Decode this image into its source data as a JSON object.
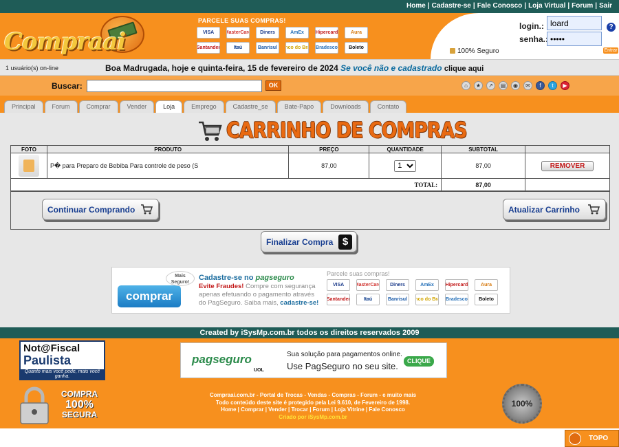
{
  "top_nav": {
    "links": [
      "Home",
      "Cadastre-se",
      "Fale Conosco",
      "Loja Virtual",
      "Forum",
      "Sair"
    ],
    "separator": "|"
  },
  "header": {
    "logo_text": "Compraai",
    "parcele_title": "PARCELE SUAS COMPRAS!",
    "cards": [
      "VISA",
      "MasterCard",
      "Diners",
      "AmEx",
      "Hipercard",
      "Aura",
      "Santander",
      "Itaú",
      "Banrisul",
      "Banco do Brasil",
      "Bradesco",
      "Boleto"
    ]
  },
  "login": {
    "login_label": "login.:",
    "login_value": "loard",
    "senha_label": "senha.:",
    "senha_value": "•••••",
    "secure_text": "100% Seguro",
    "entrar_label": "Entrar"
  },
  "infobar": {
    "online_text": "1 usuário(s) on-line",
    "greeting": "Boa Madrugada, hoje e quinta-feira, 15 de fevereiro de 2024",
    "not_registered": "Se você não e cadastrado",
    "click_here": "clique aqui"
  },
  "search": {
    "label": "Buscar:",
    "value": "",
    "ok_label": "OK"
  },
  "tabs": [
    {
      "label": "Principal",
      "active": false
    },
    {
      "label": "Forum",
      "active": false
    },
    {
      "label": "Comprar",
      "active": false
    },
    {
      "label": "Vender",
      "active": false
    },
    {
      "label": "Loja",
      "active": true
    },
    {
      "label": "Emprego",
      "active": false
    },
    {
      "label": "Cadastre_se",
      "active": false
    },
    {
      "label": "Bate-Papo",
      "active": false
    },
    {
      "label": "Downloads",
      "active": false
    },
    {
      "label": "Contato",
      "active": false
    }
  ],
  "cart": {
    "title": "CARRINHO DE COMPRAS",
    "columns": [
      "FOTO",
      "PRODUTO",
      "PREÇO",
      "QUANTIDADE",
      "SUBTOTAL",
      ""
    ],
    "items": [
      {
        "product": "P� para Preparo de Bebiba Para controle de peso (S",
        "price": "87,00",
        "quantity": "1",
        "subtotal": "87,00",
        "remove_label": "REMOVER"
      }
    ],
    "total_label": "TOTAL:",
    "total_value": "87,00",
    "continue_label": "Continuar Comprando",
    "update_label": "Atualizar Carrinho",
    "checkout_label": "Finalizar Compra",
    "checkout_icon_text": "$"
  },
  "pagseguro_banner": {
    "comprar_label": "comprar",
    "mais_seguro": "Mais Seguro!",
    "title_prefix": "Cadastre-se no",
    "title_brand": "pagseguro",
    "warning": "Evite Fraudes!",
    "text": "Compre com segurança apenas efetuando o pagamento através do PagSeguro. Saiba mais,",
    "link": "cadastre-se!",
    "parcele": "Parcele suas compras!"
  },
  "footer": {
    "credit": "Created by iSysMp.com.br todos os direitos reservados 2009",
    "nfp_top": "Not@Fiscal",
    "nfp_bottom": "Paulista",
    "nfp_tag": "Quanto mais você pede, mais você ganha.",
    "secure_w1": "COMPRA",
    "secure_w2": "100%",
    "secure_w3": "SEGURA",
    "ad_brand": "pagseguro",
    "ad_uol": "UOL",
    "ad_line1": "Sua solução para pagamentos online.",
    "ad_line2": "Use PagSeguro no seu site.",
    "ad_button": "CLIQUE",
    "line1": "Compraai.com.br - Portal de Trocas - Vendas - Compras - Forum - e muito mais",
    "line2": "Todo conteúdo deste site é protegido pela Lei 9.610, de Fevereiro de 1998.",
    "line3": "Home | Comprar | Vender | Trocar | Forum | Loja Vitrine | Fale Conosco",
    "line4": "Criado por iSysMp.com.br",
    "badge_text": "100%",
    "topo_label": "TOPO"
  }
}
